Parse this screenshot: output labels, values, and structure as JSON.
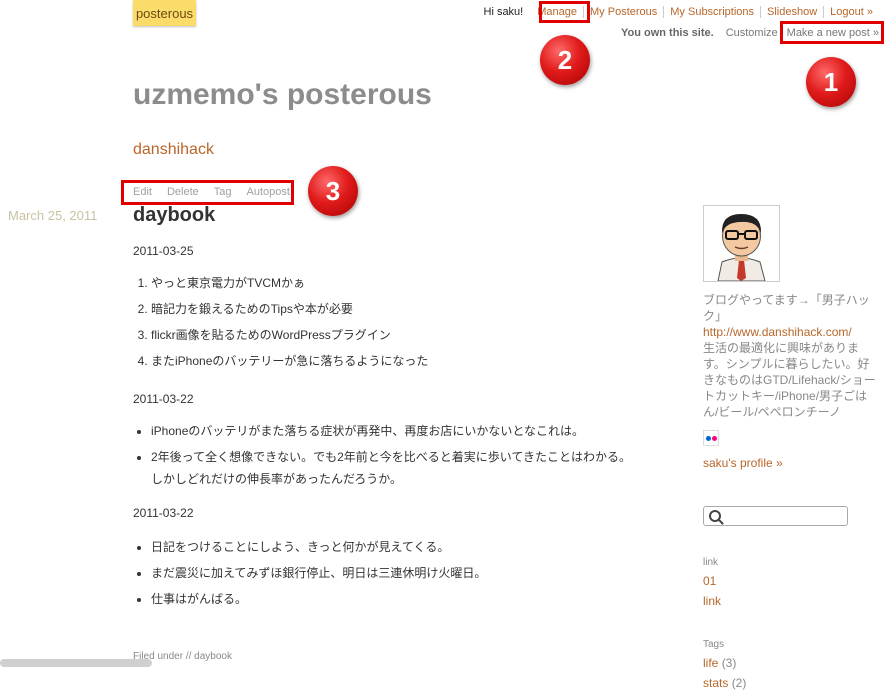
{
  "header": {
    "logo": "posterous",
    "greeting": "Hi saku!",
    "nav": [
      "Manage",
      "My Posterous",
      "My Subscriptions",
      "Slideshow",
      "Logout »"
    ],
    "own_text": "You own this site.",
    "customize": "Customize",
    "new_post": "Make a new post »"
  },
  "annotations": [
    "1",
    "2",
    "3"
  ],
  "site_title": "uzmemo's posterous",
  "category": "danshihack",
  "post_tools": [
    "Edit",
    "Delete",
    "Tag",
    "Autopost"
  ],
  "post": {
    "date": "March 25, 2011",
    "title": "daybook",
    "sections": [
      {
        "date": "2011-03-25",
        "items": [
          "やっと東京電力がTVCMかぁ",
          "暗記力を鍛えるためのTipsや本が必要",
          "flickr画像を貼るためのWordPressプラグイン",
          "またiPhoneのバッテリーが急に落ちるようになった"
        ]
      },
      {
        "date": "2011-03-22",
        "items": [
          "iPhoneのバッテリがまた落ちる症状が再発中、再度お店にいかないとなこれは。",
          "2年後って全く想像できない。でも2年前と今を比べると着実に歩いてきたことはわかる。しかしどれだけの伸長率があったんだろうか。"
        ]
      },
      {
        "date": "2011-03-22",
        "items": [
          "日記をつけることにしよう、きっと何かが見えてくる。",
          "まだ震災に加えてみずほ銀行停止、明日は三連休明け火曜日。",
          "仕事はがんばる。"
        ]
      }
    ],
    "filed_under": "Filed under // daybook"
  },
  "sidebar": {
    "bio_text": "ブログやってます→「男子ハック」",
    "bio_link": "http://www.danshihack.com/",
    "bio_rest": "生活の最適化に興味があります。シンプルに暮らしたい。好きなものはGTD/Lifehack/ショートカットキー/iPhone/男子ごはん/ビール/ペペロンチーノ",
    "profile_link": "saku's profile »",
    "link_heading": "link",
    "links": [
      "01",
      "link"
    ],
    "tags_heading": "Tags",
    "tags": [
      {
        "name": "life",
        "count": "(3)"
      },
      {
        "name": "stats",
        "count": "(2)"
      }
    ]
  },
  "colors": {
    "accent": "#b8662a",
    "logo_bg": "#fbdc6b",
    "highlight": "#e00000"
  }
}
